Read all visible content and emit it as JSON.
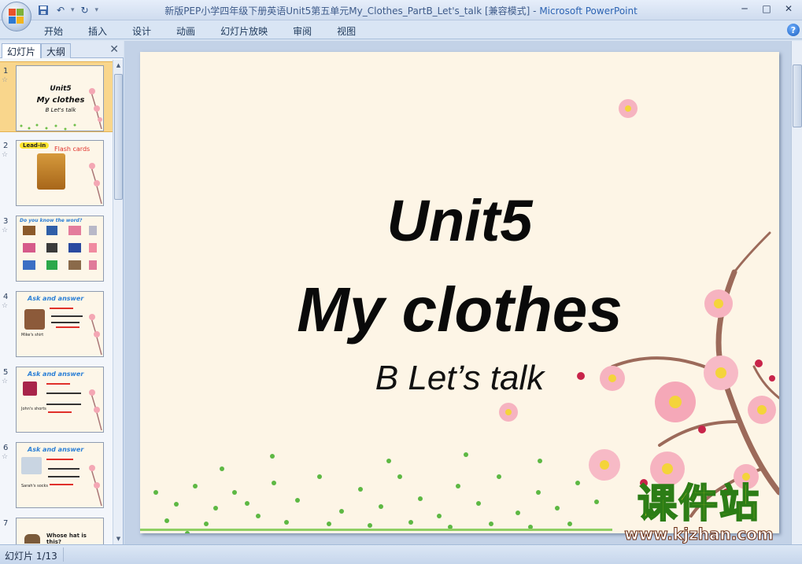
{
  "window": {
    "title": "新版PEP小学四年级下册英语Unit5第五单元My_Clothes_PartB_Let's_talk [兼容模式]",
    "app_name": "Microsoft PowerPoint"
  },
  "ribbon": {
    "tabs": [
      "开始",
      "插入",
      "设计",
      "动画",
      "幻灯片放映",
      "审阅",
      "视图"
    ]
  },
  "panel": {
    "tabs": [
      "幻灯片",
      "大纲"
    ],
    "thumbnails": [
      {
        "number": "1",
        "lines": [
          "Unit5",
          "My clothes",
          "B Let's talk"
        ]
      },
      {
        "number": "2",
        "lines": [
          "Lead-in",
          "Flash cards"
        ]
      },
      {
        "number": "3",
        "lines": [
          "Do you know the word?"
        ]
      },
      {
        "number": "4",
        "lines": [
          "Ask and answer",
          "Mike's shirt"
        ]
      },
      {
        "number": "5",
        "lines": [
          "Ask and answer",
          "John's shorts"
        ]
      },
      {
        "number": "6",
        "lines": [
          "Ask and answer",
          "Sarah's socks"
        ]
      },
      {
        "number": "7",
        "lines": [
          "Whose hat is this?"
        ]
      }
    ]
  },
  "slide": {
    "title_line1": "Unit5",
    "title_line2": "My clothes",
    "subtitle": "B Let’s talk"
  },
  "watermark": {
    "chinese": "课件站",
    "url": "www.kjzhan.com"
  },
  "status": {
    "slide_counter": "幻灯片 1/13"
  }
}
